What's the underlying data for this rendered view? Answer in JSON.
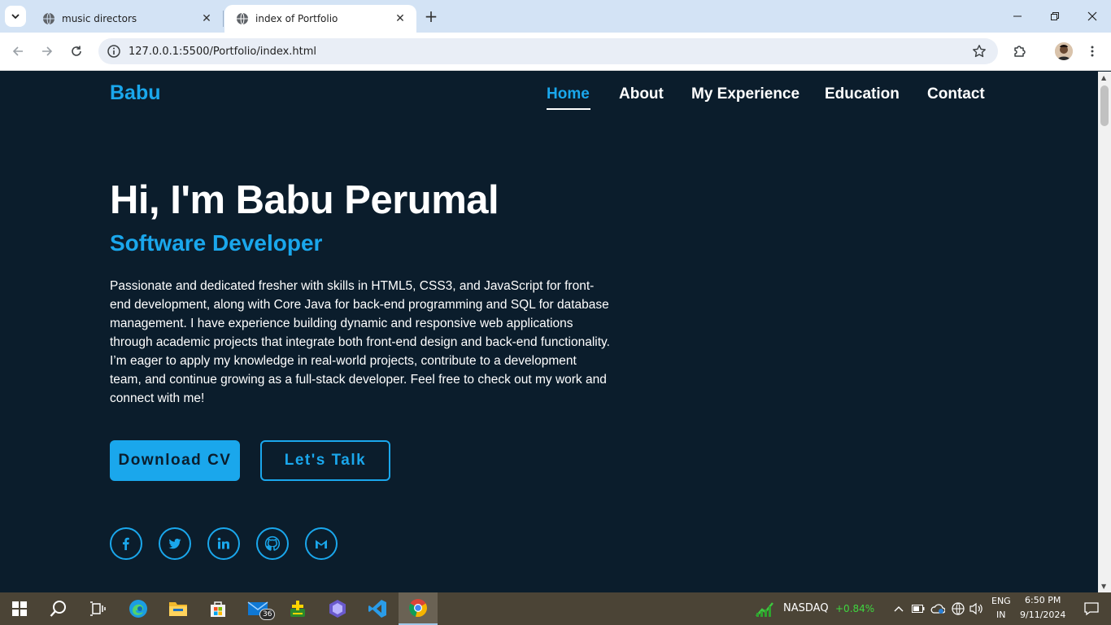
{
  "browser": {
    "tabs": [
      {
        "title": "music directors",
        "active": false
      },
      {
        "title": "index of Portfolio",
        "active": true
      }
    ],
    "url": "127.0.0.1:5500/Portfolio/index.html"
  },
  "site": {
    "logo": "Babu",
    "nav": [
      {
        "label": "Home",
        "active": true
      },
      {
        "label": "About",
        "active": false
      },
      {
        "label": "My Experience",
        "active": false
      },
      {
        "label": "Education",
        "active": false
      },
      {
        "label": "Contact",
        "active": false
      }
    ],
    "hero": {
      "title": "Hi, I'm Babu Perumal",
      "subtitle": "Software Developer",
      "description": "Passionate and dedicated fresher with skills in HTML5, CSS3, and JavaScript for front-end development, along with Core Java for back-end programming and SQL for database management. I have experience building dynamic and responsive web applications through academic projects that integrate both front-end design and back-end functionality. I’m eager to apply my knowledge in real-world projects, contribute to a development team, and continue growing as a full-stack developer. Feel free to check out my work and connect with me!",
      "download_cv": "Download CV",
      "lets_talk": "Let's Talk"
    },
    "social": [
      "facebook-icon",
      "twitter-icon",
      "linkedin-icon",
      "github-icon",
      "gmail-icon"
    ],
    "colors": {
      "background": "#0b1d2c",
      "accent": "#1aa7ec",
      "text": "#ffffff"
    }
  },
  "taskbar": {
    "mail_badge": "36",
    "stock_name": "NASDAQ",
    "stock_change": "+0.84%",
    "lang_top": "ENG",
    "lang_bottom": "IN",
    "time": "6:50 PM",
    "date": "9/11/2024"
  }
}
